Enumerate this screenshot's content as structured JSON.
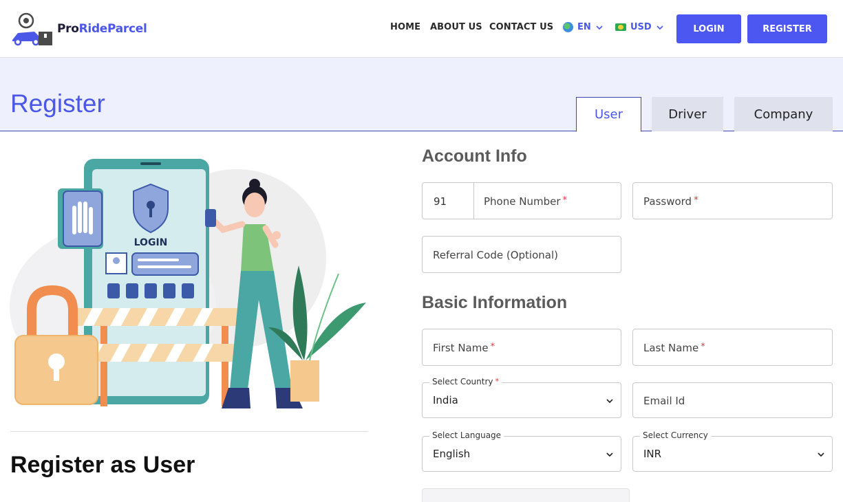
{
  "header": {
    "logo": {
      "pro": "Pro",
      "ride_parcel": "RideParcel"
    },
    "nav": {
      "home": "HOME",
      "about": "ABOUT US",
      "contact": "CONTACT US"
    },
    "language": {
      "icon": "globe-icon",
      "value": "EN"
    },
    "currency": {
      "icon": "flag-icon",
      "value": "USD"
    },
    "buttons": {
      "login": "LOGIN",
      "register": "REGISTER"
    }
  },
  "banner": {
    "title": "Register",
    "tabs": [
      {
        "label": "User",
        "active": true
      },
      {
        "label": "Driver",
        "active": false
      },
      {
        "label": "Company",
        "active": false
      }
    ]
  },
  "illustration": {
    "screen_label": "LOGIN"
  },
  "left": {
    "subtitle": "Register as User"
  },
  "form": {
    "account_info": {
      "title": "Account Info",
      "phone_code": "91",
      "phone_placeholder": "Phone Number",
      "password_placeholder": "Password",
      "referral_placeholder": "Referral Code (Optional)"
    },
    "basic_info": {
      "title": "Basic Information",
      "first_name": "First Name",
      "last_name": "Last Name",
      "country_label": "Select Country",
      "country_value": "India",
      "email_placeholder": "Email Id",
      "language_label": "Select Language",
      "language_value": "English",
      "currency_label": "Select Currency",
      "currency_value": "INR"
    },
    "required_marker": "*"
  },
  "colors": {
    "accent": "#4b57e6",
    "button": "#4b57f0",
    "banner_bg": "#eef0fd",
    "required": "#e0393b"
  }
}
